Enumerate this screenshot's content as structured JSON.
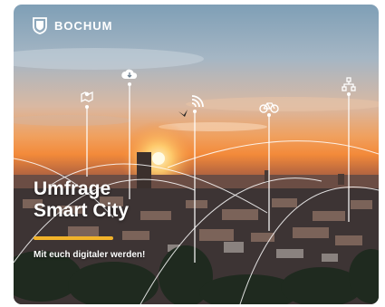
{
  "brand": {
    "name": "BOCHUM",
    "icon": "bochum-shield-logo"
  },
  "campaign": {
    "title_line1": "Umfrage",
    "title_line2": "Smart City",
    "subtitle": "Mit euch digitaler werden!",
    "accent_color": "#f2b32a"
  },
  "icons": [
    "map-pin-icon",
    "cloud-download-icon",
    "wifi-icon",
    "bicycle-icon",
    "network-icon"
  ]
}
